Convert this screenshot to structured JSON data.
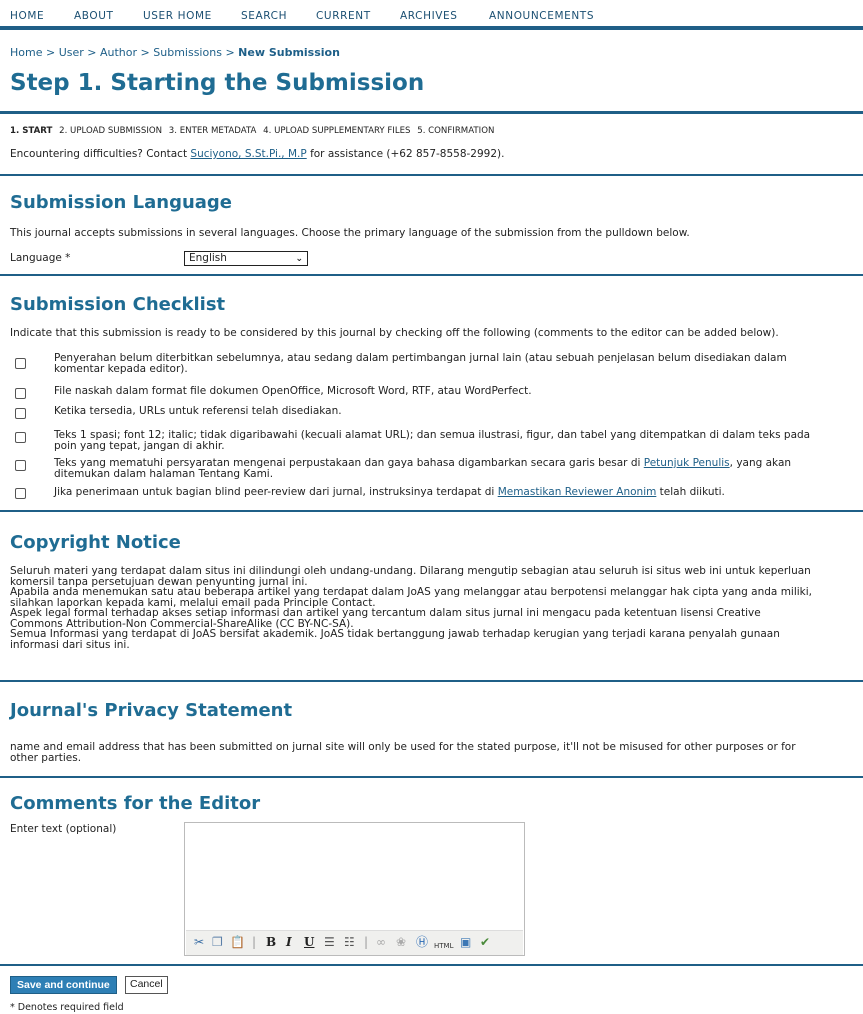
{
  "nav": {
    "items": [
      "HOME",
      "ABOUT",
      "USER HOME",
      "SEARCH",
      "CURRENT",
      "ARCHIVES",
      "ANNOUNCEMENTS"
    ]
  },
  "breadcrumb": {
    "home": "Home",
    "user": "User",
    "author": "Author",
    "submissions": "Submissions",
    "current": "New Submission",
    "sep": ">"
  },
  "page": {
    "title": "Step 1. Starting the Submission"
  },
  "steps": [
    "1. START",
    "2. UPLOAD SUBMISSION",
    "3. ENTER METADATA",
    "4. UPLOAD SUPPLEMENTARY FILES",
    "5. CONFIRMATION"
  ],
  "contact": {
    "prefix": "Encountering difficulties? Contact",
    "name": "Suciyono, S.St.Pi., M.P",
    "suffix": "for assistance (+62 857-8558-2992)."
  },
  "language": {
    "heading": "Submission Language",
    "intro": "This journal accepts submissions in several languages. Choose the primary language of the submission from the pulldown below.",
    "label": "Language *",
    "selected": "English"
  },
  "checklist": {
    "heading": "Submission Checklist",
    "intro": "Indicate that this submission is ready to be considered by this journal by checking off the following (comments to the editor can be added below).",
    "items": [
      {
        "line1": "Penyerahan belum diterbitkan sebelumnya, atau sedang dalam pertimbangan jurnal lain (atau sebuah penjelasan belum disediakan dalam",
        "line2": "komentar kepada editor)."
      },
      {
        "line1": "File naskah dalam format file dokumen OpenOffice, Microsoft Word, RTF, atau WordPerfect."
      },
      {
        "line1": "Ketika tersedia, URLs untuk referensi telah disediakan."
      },
      {
        "line1": "Teks 1 spasi; font 12; italic; tidak digaribawahi (kecuali alamat URL); dan semua ilustrasi, figur, dan tabel yang ditempatkan di dalam teks pada",
        "line2": "poin yang tepat, jangan di akhir."
      },
      {
        "line1_pre": "Teks yang mematuhi persyaratan mengenai perpustakaan dan gaya bahasa digambarkan secara garis besar di",
        "line1_link": "Petunjuk Penulis",
        "line1_post": ", yang akan",
        "line2": "ditemukan dalam halaman Tentang Kami."
      },
      {
        "line1_pre": "Jika penerimaan untuk bagian blind peer-review dari jurnal, instruksinya terdapat di",
        "line1_link": "Memastikan Reviewer Anonim",
        "line1_post": " telah diikuti."
      }
    ]
  },
  "copyright": {
    "heading": "Copyright Notice",
    "lines": [
      "Seluruh materi yang terdapat dalam situs ini dilindungi oleh undang-undang. Dilarang mengutip sebagian atau seluruh isi situs web ini untuk keperluan",
      "komersil tanpa persetujuan dewan penyunting jurnal ini.",
      "Apabila anda menemukan satu atau beberapa artikel yang terdapat dalam JoAS yang melanggar atau berpotensi melanggar hak cipta yang anda miliki,",
      "silahkan laporkan kepada kami, melalui email pada Principle Contact.",
      "Aspek legal formal terhadap akses setiap informasi dan artikel yang tercantum dalam situs jurnal ini mengacu pada ketentuan lisensi Creative",
      "Commons Attribution-Non Commercial-ShareAlike (CC BY-NC-SA).",
      "Semua Informasi yang terdapat di JoAS bersifat akademik. JoAS tidak bertanggung jawab terhadap kerugian yang terjadi karana penyalah gunaan",
      "informasi dari situs ini."
    ]
  },
  "privacy": {
    "heading": "Journal's Privacy Statement",
    "lines": [
      "name and email address that has been submitted on jurnal site will only be used for the stated purpose, it'll not be misused for other purposes or for",
      "other parties."
    ]
  },
  "comments": {
    "heading": "Comments for the Editor",
    "label": "Enter text (optional)",
    "toolbar": [
      "cut-icon",
      "copy-icon",
      "paste-icon",
      "bold-icon",
      "italic-icon",
      "underline-icon",
      "bullet-list-icon",
      "numbered-list-icon",
      "link-icon",
      "unlink-icon",
      "help-icon",
      "html-icon",
      "fullscreen-icon",
      "spellcheck-icon"
    ]
  },
  "actions": {
    "save": "Save and continue",
    "cancel": "Cancel"
  },
  "footnote": "* Denotes required field",
  "colors": {
    "accent": "#1f6c93",
    "rule": "#1f5f87",
    "link": "#1e5f88",
    "save_button": "#2e7fb5"
  }
}
